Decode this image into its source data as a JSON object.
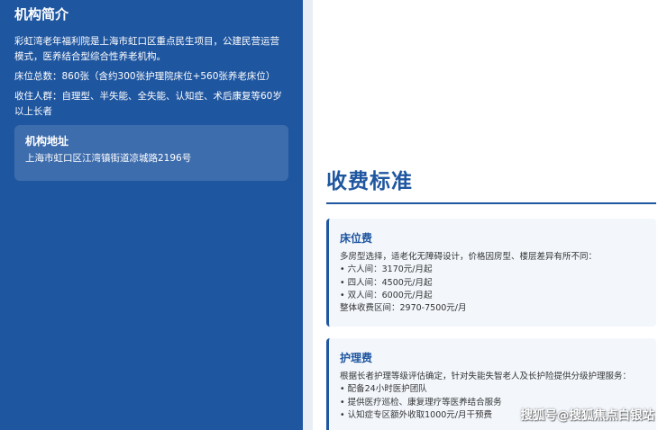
{
  "intro": {
    "title": "机构简介",
    "paragraphs": [
      "彩虹湾老年福利院是上海市虹口区重点民生项目，公建民营运营模式，医养结合型综合性养老机构。",
      "床位总数：860张（含约300张护理院床位+560张养老床位）",
      "收住人群：自理型、半失能、全失能、认知症、术后康复等60岁以上长者"
    ]
  },
  "address": {
    "title": "机构地址",
    "text": "上海市虹口区江湾镇街道凉城路2196号"
  },
  "fees": {
    "title": "收费标准",
    "cards": [
      {
        "title": "床位费",
        "lines": [
          "多房型选择，适老化无障碍设计，价格因房型、楼层差异有所不同：",
          "• 六人间：3170元/月起",
          "• 四人间：4500元/月起",
          "• 双人间：6000元/月起",
          "整体收费区间：2970-7500元/月"
        ]
      },
      {
        "title": "护理费",
        "lines": [
          "根据长者护理等级评估确定，针对失能失智老人及长护险提供分级护理服务：",
          "• 配备24小时医护团队",
          "• 提供医疗巡检、康复理疗等医养结合服务",
          "• 认知症专区额外收取1000元/月干预费"
        ]
      }
    ]
  },
  "watermark": "搜狐号@搜狐焦点白银站",
  "colors": {
    "primary_blue": "#1f56a0",
    "card_bg": "#f3f7fc"
  }
}
